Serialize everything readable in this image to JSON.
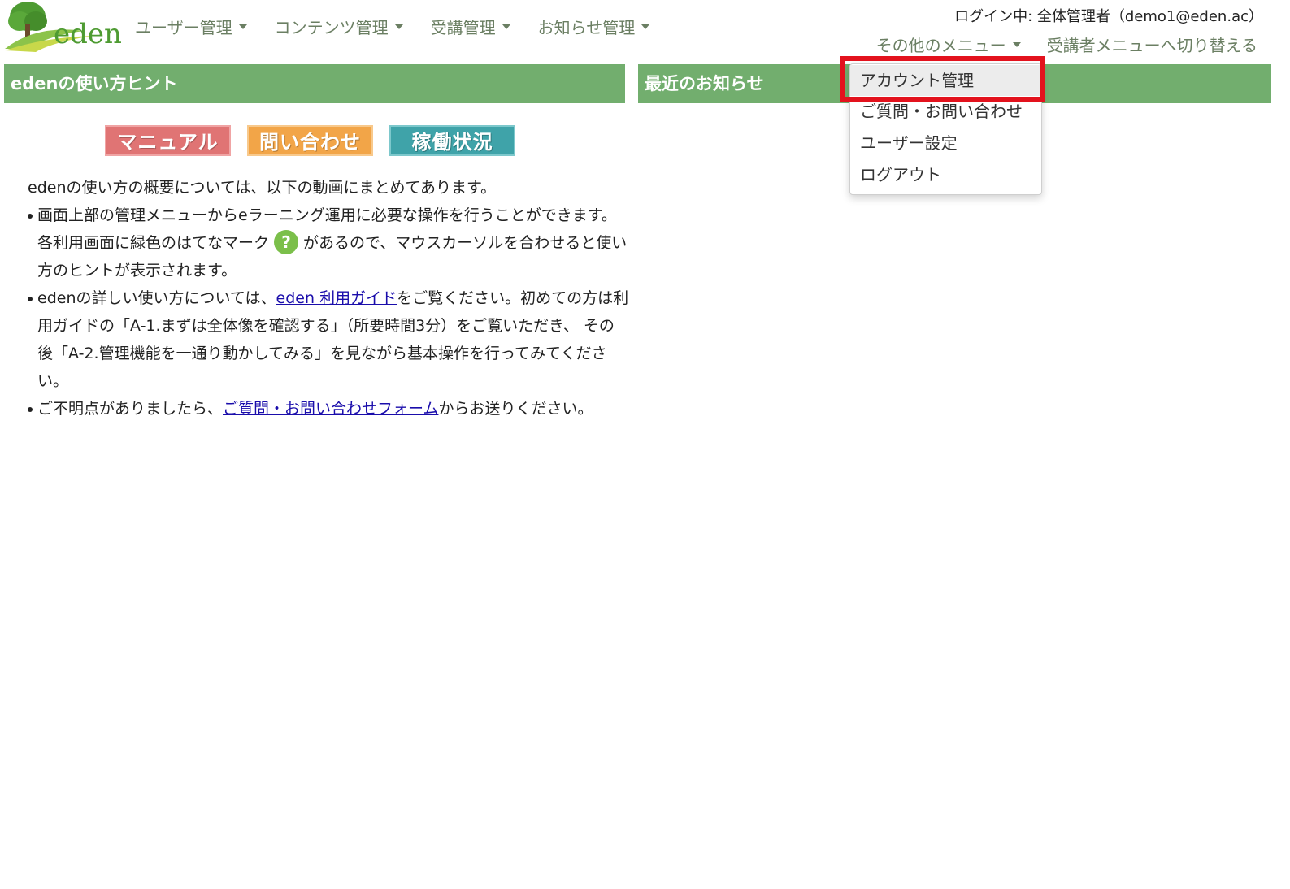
{
  "brand": {
    "logo_text": "eden"
  },
  "nav": {
    "items": [
      {
        "label": "ユーザー管理"
      },
      {
        "label": "コンテンツ管理"
      },
      {
        "label": "受講管理"
      },
      {
        "label": "お知らせ管理"
      }
    ],
    "other_menu": "その他のメニュー",
    "switch_menu": "受講者メニューへ切り替える"
  },
  "login": {
    "text": "ログイン中: 全体管理者（demo1@eden.ac）"
  },
  "hints": {
    "title": "edenの使い方ヒント",
    "banners": {
      "manual": "マニュアル",
      "contact": "問い合わせ",
      "status": "稼働状況"
    },
    "intro": "edenの使い方の概要については、以下の動画にまとめてあります。",
    "item1_a": "画面上部の管理メニューからeラーニング運用に必要な操作を行うことができます。各利用画面に緑色のはてなマーク",
    "item1_icon": "?",
    "item1_b": "があるので、マウスカーソルを合わせると使い方のヒントが表示されます。",
    "item2_a": "edenの詳しい使い方については、",
    "item2_link": "eden 利用ガイド",
    "item2_b": "をご覧ください。初めての方は利用ガイドの「A-1.まずは全体像を確認する」（所要時間3分）をご覧いただき、 その後「A-2.管理機能を一通り動かしてみる」を見ながら基本操作を行ってみてください。",
    "item3_a": "ご不明点がありましたら、",
    "item3_link": "ご質問・お問い合わせフォーム",
    "item3_b": "からお送りください。"
  },
  "news": {
    "title": "最近のお知らせ"
  },
  "dropdown": {
    "items": [
      {
        "label": "アカウント管理"
      },
      {
        "label": "ご質問・お問い合わせ"
      },
      {
        "label": "ユーザー設定"
      },
      {
        "label": "ログアウト"
      }
    ]
  },
  "colors": {
    "header_green": "#72ae6e",
    "highlight_red": "#e3121d",
    "link_blue": "#1a0dab"
  }
}
